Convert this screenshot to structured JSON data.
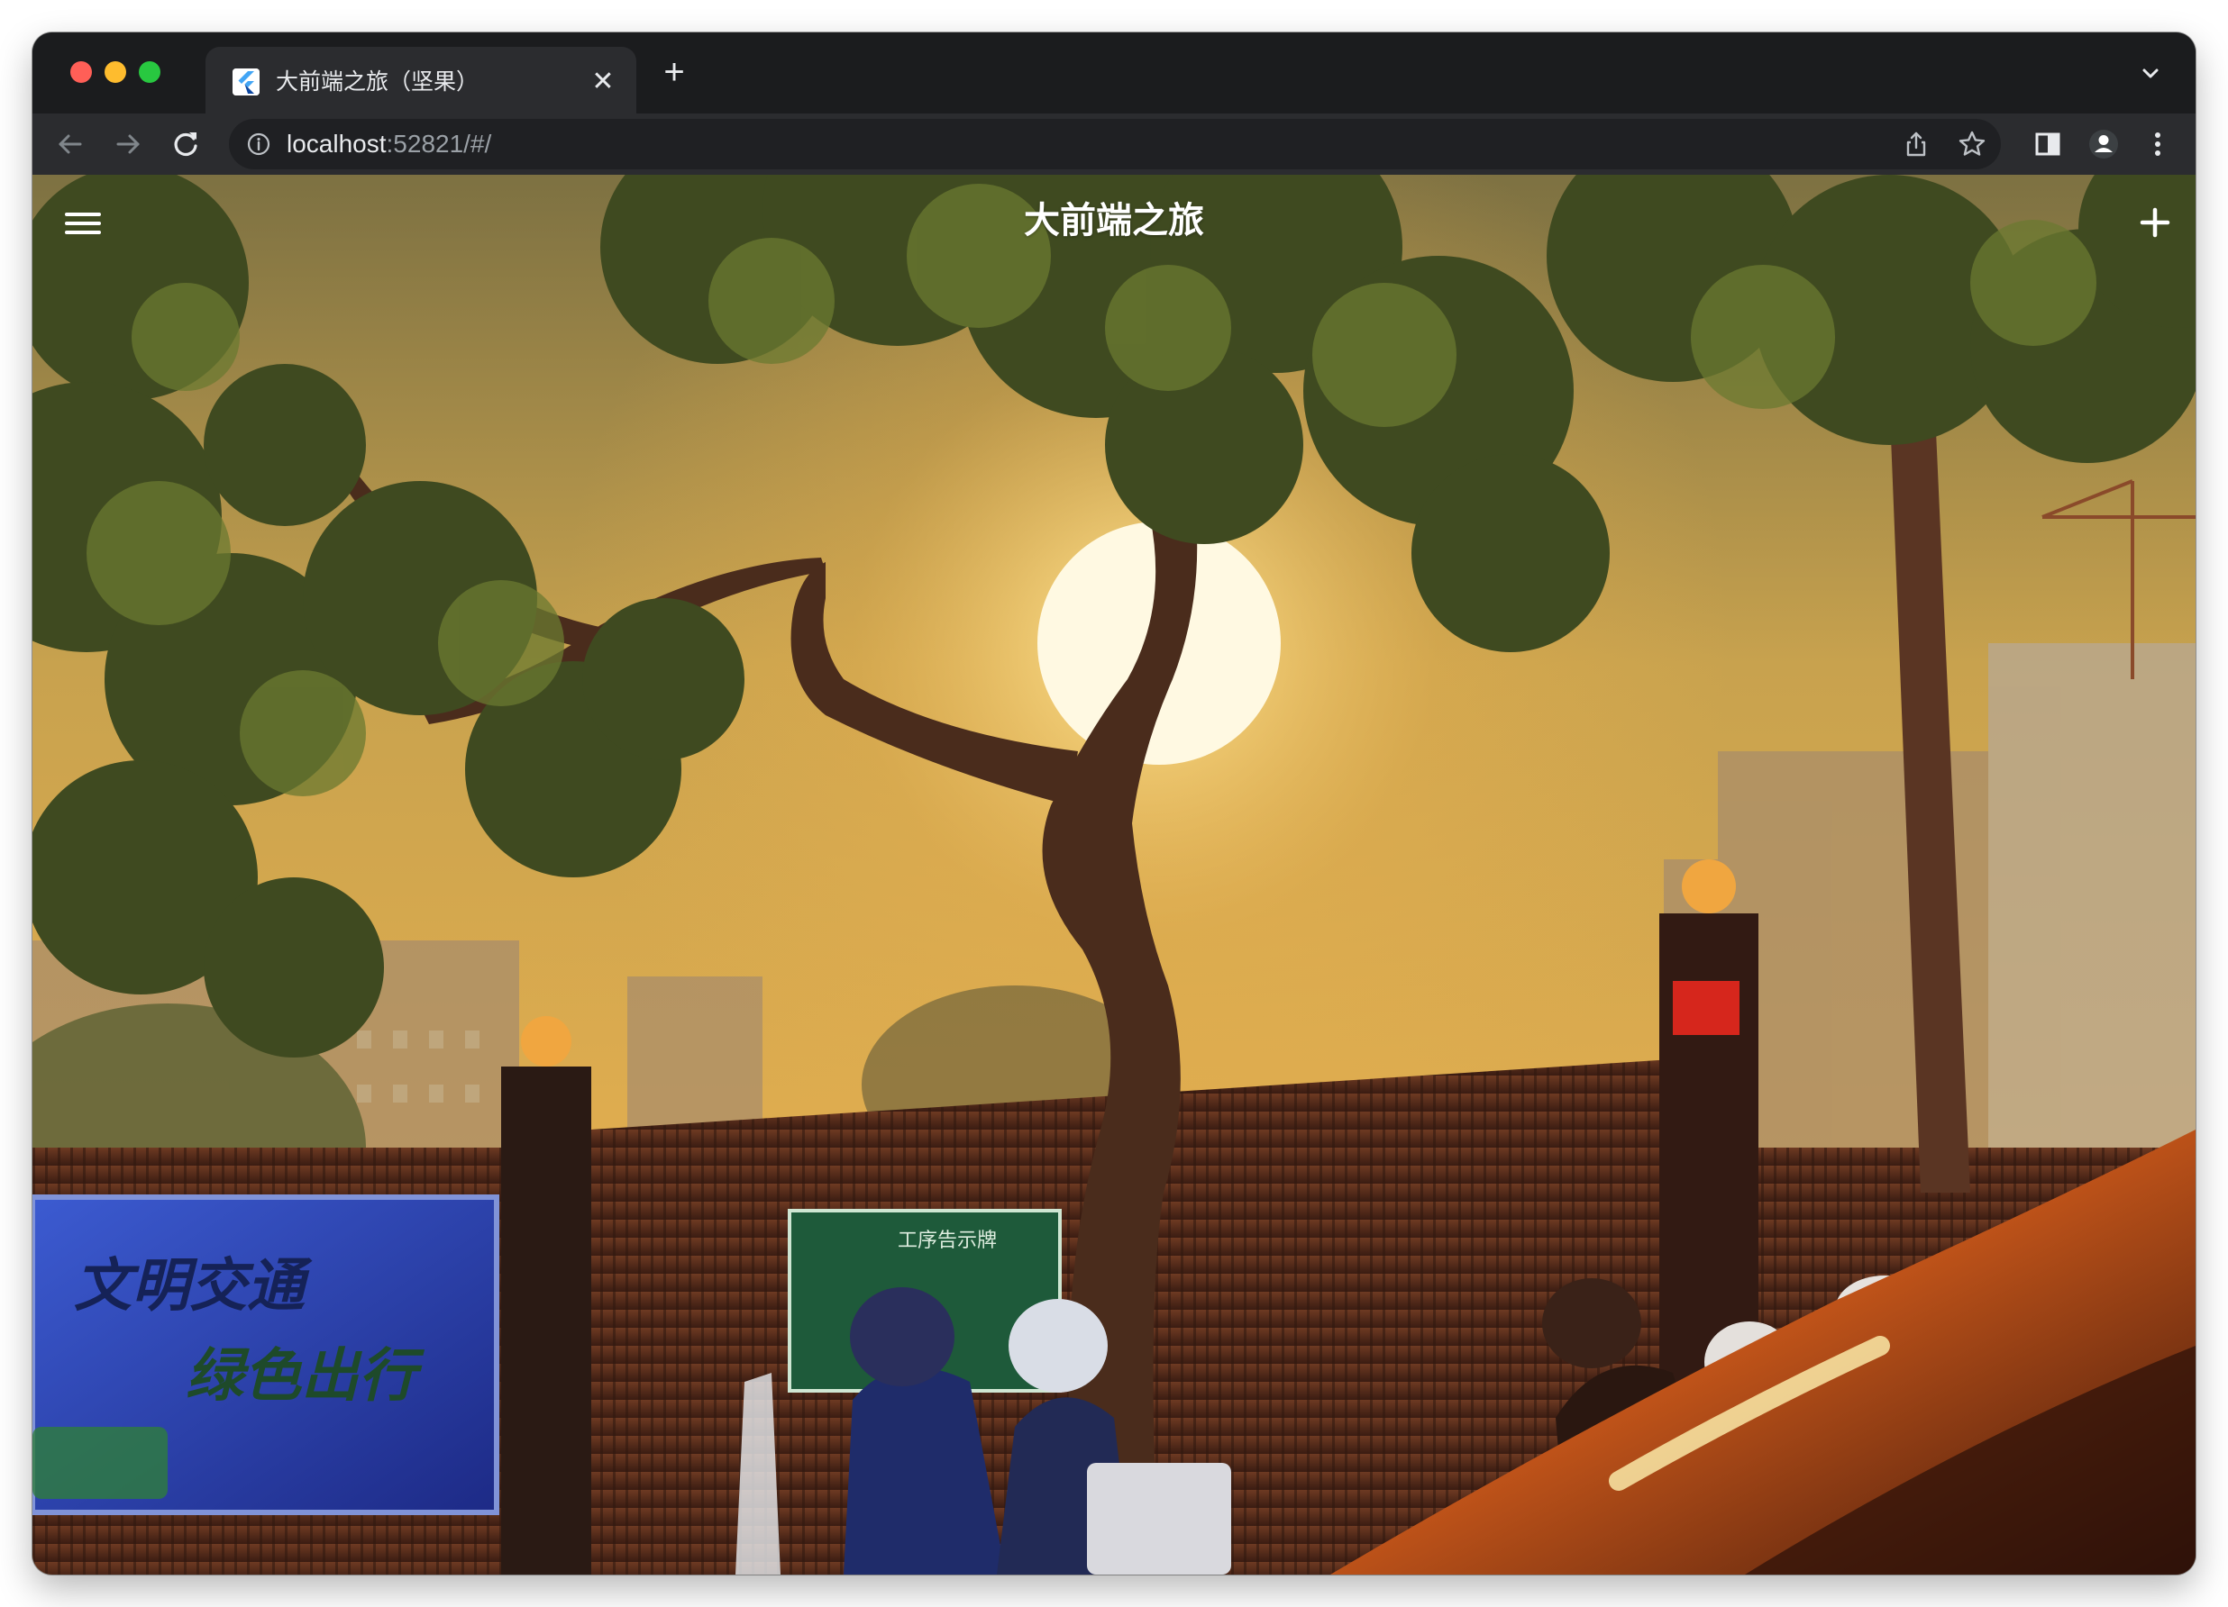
{
  "browser": {
    "tab": {
      "title": "大前端之旅（坚果）",
      "close_glyph": "✕",
      "favicon": "flutter-icon"
    },
    "new_tab_glyph": "+",
    "address_bar": {
      "host": "localhost",
      "rest": ":52821/#/"
    },
    "icons": {
      "back": "back-arrow-icon",
      "forward": "forward-arrow-icon",
      "reload": "reload-icon",
      "site_info": "info-icon",
      "share": "share-icon",
      "bookmark": "star-icon",
      "side_panel": "side-panel-icon",
      "profile": "profile-icon",
      "menu": "kebab-menu-icon",
      "tab_search": "chevron-down-icon"
    }
  },
  "app": {
    "title": "大前端之旅",
    "menu_icon": "hamburger-menu-icon",
    "add_icon": "plus-icon",
    "background_photo": {
      "billboard_text_line1": "文明交通",
      "billboard_text_line2": "绿色出行",
      "sign_text": "工序告示牌"
    }
  },
  "colors": {
    "close": "#ff5f57",
    "minimize": "#febc2e",
    "maximize": "#28c840",
    "tabstrip": "#1b1c1e",
    "toolbar": "#2b2c2f",
    "sky_top": "#8a7a4a",
    "sky_glow": "#e8b243"
  }
}
